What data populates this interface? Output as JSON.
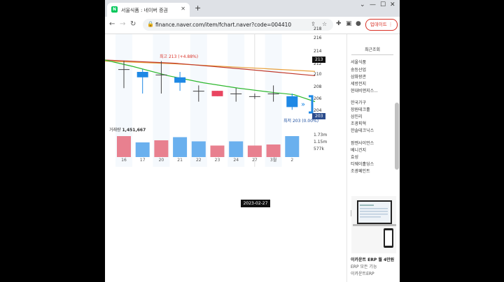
{
  "browser": {
    "tab_title": "서울식품 : 네이버 증권",
    "favicon": "N",
    "url": "finance.naver.com/item/fchart.naver?code=004410",
    "update_label": "업데이트"
  },
  "chart": {
    "y_axis_labels": [
      "218",
      "216",
      "214",
      "212",
      "210",
      "208",
      "206",
      "204"
    ],
    "current_price_tag": "213",
    "low_price_tag": "203",
    "high_label": "최고 213 (+4.88%)",
    "low_label": "최저 203 (0.00%)",
    "volume_title": "거래량",
    "volume_value": "1,451,667",
    "volume_axis_labels": [
      "1.73m",
      "1.15m",
      "577k"
    ],
    "date_tooltip": "2023-02-27",
    "x_labels": [
      "16",
      "17",
      "20",
      "21",
      "22",
      "23",
      "24",
      "27",
      "3월",
      "2"
    ]
  },
  "chart_data": {
    "type": "candlestick",
    "categories": [
      "16",
      "17",
      "20",
      "21",
      "22",
      "23",
      "24",
      "27",
      "3월",
      "2"
    ],
    "candles": [
      {
        "open": 211.5,
        "close": 211.5,
        "high": 213,
        "low": 208,
        "up": false
      },
      {
        "open": 211,
        "close": 210,
        "high": 211.5,
        "low": 207,
        "up": false
      },
      {
        "open": 210.5,
        "close": 210.5,
        "high": 213,
        "low": 207,
        "up": false
      },
      {
        "open": 210,
        "close": 209,
        "high": 211,
        "low": 207.5,
        "up": false
      },
      {
        "open": 207.5,
        "close": 207.5,
        "high": 208.5,
        "low": 205.5,
        "up": false
      },
      {
        "open": 206.5,
        "close": 207.5,
        "high": 207.5,
        "low": 206.5,
        "up": true
      },
      {
        "open": 207,
        "close": 207,
        "high": 208,
        "low": 205.5,
        "up": false
      },
      {
        "open": 206.5,
        "close": 206.5,
        "high": 207,
        "low": 206,
        "up": false
      },
      {
        "open": 207,
        "close": 207,
        "high": 208.5,
        "low": 205.5,
        "up": false
      },
      {
        "open": 206.5,
        "close": 204.5,
        "high": 207,
        "low": 204,
        "up": false
      }
    ],
    "volumes": [
      1.0,
      0.7,
      0.8,
      0.95,
      0.75,
      0.55,
      0.75,
      0.55,
      0.6,
      1.0
    ],
    "volume_up": [
      true,
      false,
      true,
      false,
      false,
      true,
      false,
      true,
      true,
      false
    ],
    "ylim": [
      203,
      219
    ],
    "colors": {
      "up": "#e94560",
      "down": "#1e88e5",
      "ma_green": "#2eb82e",
      "ma_orange": "#e8a03c",
      "ma_red": "#c0392b",
      "ma_purple": "#6a2c91"
    }
  },
  "sidebar": {
    "header": "최근조회",
    "items": [
      "서울식품",
      "숭등산업",
      "삼화왕관",
      "세방전지",
      "현대비앤지스...",
      "한국가구",
      "장원테크홀",
      "삼진리",
      "조광피혁",
      "한솔테크닉스",
      "팜젠사이언스",
      "베니건지",
      "효성",
      "티웨이홀딩스",
      "조광페인트"
    ],
    "ad_title": "이카운트 ERP 월 4만원",
    "ad_sub1": "ERP 모든 기능",
    "ad_sub2": "이카운트ERP"
  }
}
